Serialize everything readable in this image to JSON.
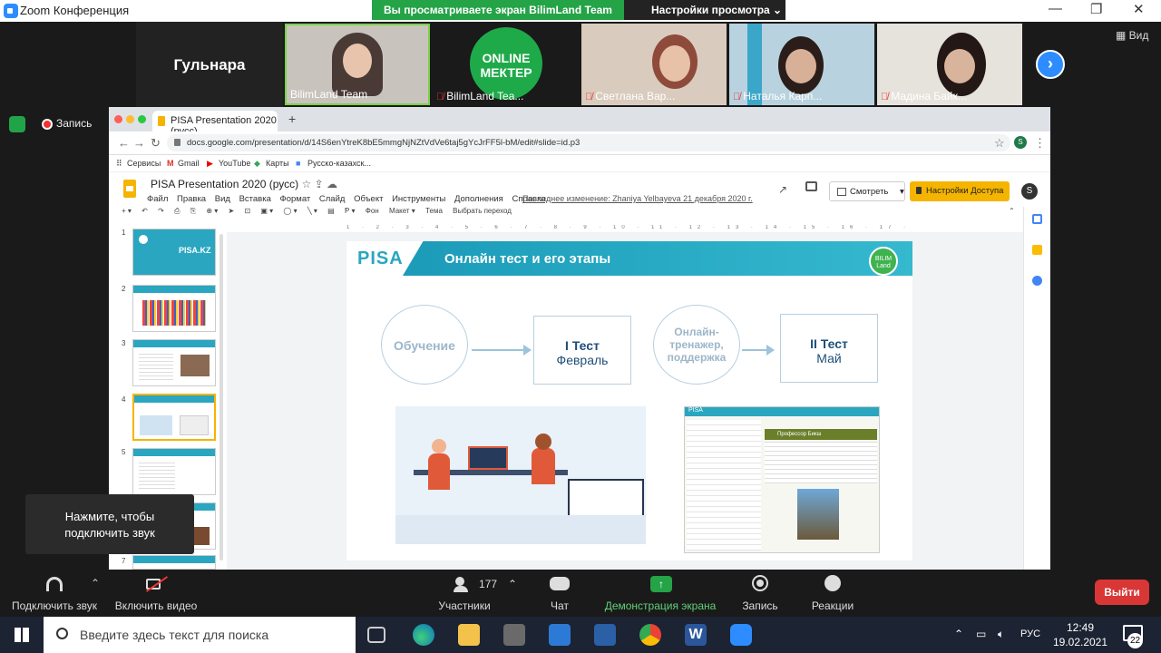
{
  "zoom": {
    "window_title": "Zoom Конференция",
    "share_banner": "Вы просматриваете экран BilimLand Team",
    "view_settings": "Настройки просмотра",
    "view_button": "Вид",
    "recording_label": "Запись",
    "speaker_name": "Гульнара",
    "participants": [
      {
        "name": "BilimLand Team",
        "muted": false
      },
      {
        "name": "BilimLand Tea...",
        "muted": true
      },
      {
        "name": "Светлана Вар...",
        "muted": true
      },
      {
        "name": "Наталья Карп...",
        "muted": true
      },
      {
        "name": "Мадина Байк...",
        "muted": true
      }
    ],
    "online_mekter": [
      "ONLINE",
      "МЕКТЕР"
    ],
    "audio_tooltip": [
      "Нажмите, чтобы",
      "подключить звук"
    ],
    "controls": {
      "audio": "Подключить звук",
      "video": "Включить видео",
      "participants": "Участники",
      "participants_count": "177",
      "chat": "Чат",
      "share": "Демонстрация экрана",
      "record": "Запись",
      "reactions": "Реакции",
      "leave": "Выйти"
    }
  },
  "browser": {
    "tab_title": "PISA Presentation 2020 (русс)",
    "url": "docs.google.com/presentation/d/14S6enYtreK8bE5mmgNjNZtVdVe6taj5gYcJrFF5l-bM/edit#slide=id.p3",
    "bookmarks": [
      "Сервисы",
      "Gmail",
      "YouTube",
      "Карты",
      "Русско-казахск..."
    ]
  },
  "docs": {
    "title": "PISA Presentation 2020 (русс)",
    "menus": [
      "Файл",
      "Правка",
      "Вид",
      "Вставка",
      "Формат",
      "Слайд",
      "Объект",
      "Инструменты",
      "Дополнения",
      "Справка"
    ],
    "last_edit": "Последнее изменение: Zhaniya Yelbayeva 21 декабря 2020 г.",
    "present": "Смотреть",
    "access": "Настройки Доступа",
    "user_initial": "S",
    "toolbar": [
      "Фон",
      "Макет ▾",
      "Тема",
      "Выбрать переход"
    ],
    "slide_numbers": [
      "1",
      "2",
      "3",
      "4",
      "5",
      "6",
      "7"
    ],
    "thumb1_title": "PISA.KZ",
    "ruler": "1 · 2 · 3 · 4 · 5 · 6 · 7 · 8 · 9 · 10 · 11 · 12 · 13 · 14 · 15 · 16 · 17 · 18 · 19 · 20 · 21 · 22 · 23 · 24 · 25"
  },
  "slide": {
    "logo": "PISA",
    "title": "Онлайн тест и его этапы",
    "badge": [
      "BILIM",
      "Land"
    ],
    "step1": "Обучение",
    "step2_line1": "I Тест",
    "step2_line2": "Февраль",
    "step3": [
      "Онлайн-",
      "тренажер,",
      "поддержка"
    ],
    "step4_line1": "II Тест",
    "step4_line2": "Май",
    "app_header": "PISA",
    "app_question": "Профессор Бикш"
  },
  "taskbar": {
    "search_placeholder": "Введите здесь текст для поиска",
    "lang": "РУС",
    "time": "12:49",
    "date": "19.02.2021",
    "notifications": "22"
  },
  "colors": {
    "zoom_blue": "#2D8CFF",
    "share_green": "#25a347",
    "leave_red": "#d93636",
    "docs_yellow": "#f5b400",
    "slide_teal": "#2aa6c0"
  }
}
